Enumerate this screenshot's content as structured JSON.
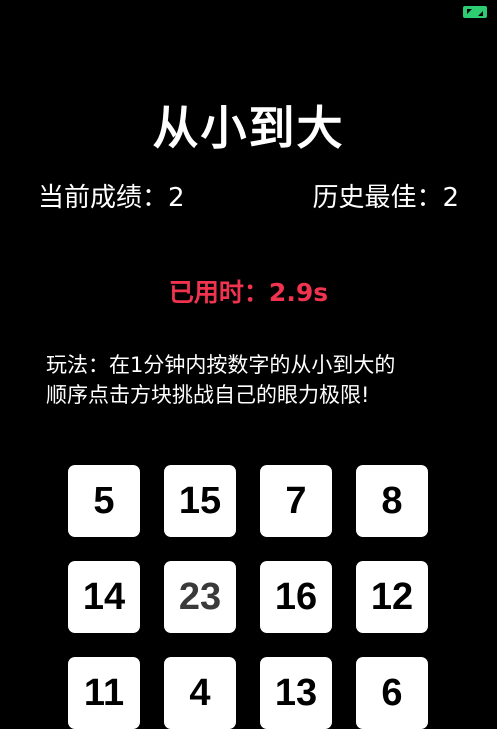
{
  "title": "从小到大",
  "score": {
    "current_label": "当前成绩：2",
    "best_label": "历史最佳：2"
  },
  "timer": {
    "label": "已用时：",
    "value": "2.9s"
  },
  "instructions": {
    "line1": "玩法：在1分钟内按数字的从小到大的",
    "line2": "顺序点击方块挑战自己的眼力极限!"
  },
  "tiles": [
    "5",
    "15",
    "7",
    "8",
    "14",
    "23",
    "16",
    "12",
    "11",
    "4",
    "13",
    "6"
  ],
  "colors": {
    "background": "#000000",
    "timer": "#f0334f",
    "tile": "#ffffff",
    "badge": "#2ecc71"
  },
  "icons": {
    "corner": "expand-arrows-icon"
  }
}
